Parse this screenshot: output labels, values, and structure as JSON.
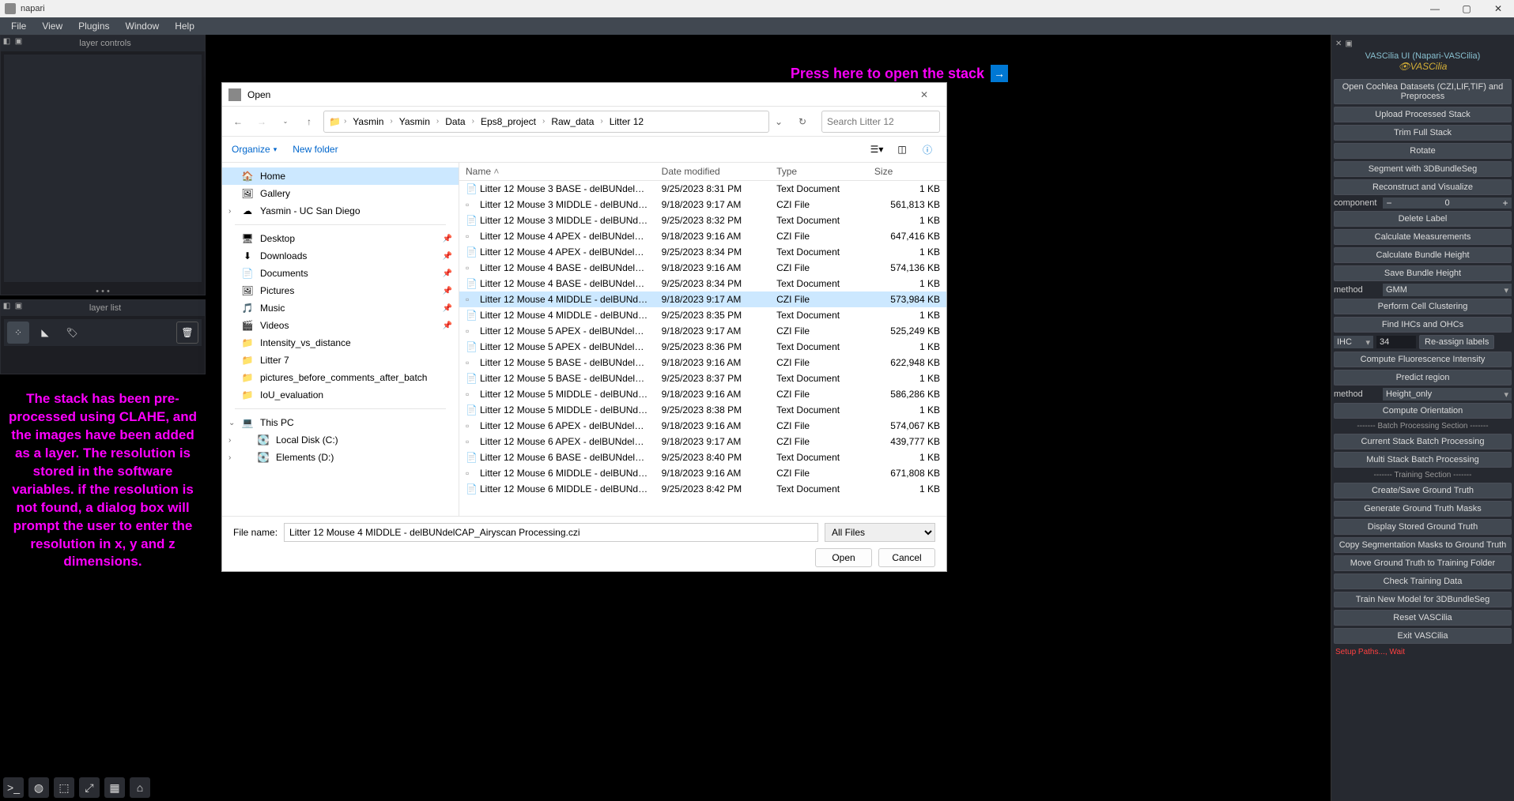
{
  "title": "napari",
  "menu": [
    "File",
    "View",
    "Plugins",
    "Window",
    "Help"
  ],
  "panels": {
    "layer_controls": "layer controls",
    "layer_list": "layer list"
  },
  "annotations": {
    "left": "The stack has been pre-processed using CLAHE, and the images have been added as a layer. The resolution is stored in the software variables. if the resolution is not found, a dialog box will prompt the user to enter the resolution in x, y and z dimensions.",
    "top": "Press here to open the stack"
  },
  "dialog": {
    "title": "Open",
    "breadcrumb": [
      "Yasmin",
      "Yasmin",
      "Data",
      "Eps8_project",
      "Raw_data",
      "Litter 12"
    ],
    "search_placeholder": "Search Litter 12",
    "organize": "Organize",
    "new_folder": "New folder",
    "sidebar_top": [
      {
        "icon": "🏠",
        "label": "Home",
        "selected": true
      },
      {
        "icon": "🖼",
        "label": "Gallery"
      },
      {
        "icon": "☁",
        "label": "Yasmin - UC San Diego",
        "expander": "›"
      }
    ],
    "sidebar_mid": [
      {
        "icon": "🖥",
        "label": "Desktop",
        "pin": true
      },
      {
        "icon": "⬇",
        "label": "Downloads",
        "pin": true
      },
      {
        "icon": "📄",
        "label": "Documents",
        "pin": true
      },
      {
        "icon": "🖼",
        "label": "Pictures",
        "pin": true
      },
      {
        "icon": "🎵",
        "label": "Music",
        "pin": true
      },
      {
        "icon": "🎬",
        "label": "Videos",
        "pin": true
      },
      {
        "icon": "📁",
        "label": "Intensity_vs_distance"
      },
      {
        "icon": "📁",
        "label": "Litter 7"
      },
      {
        "icon": "📁",
        "label": "pictures_before_comments_after_batch"
      },
      {
        "icon": "📁",
        "label": "IoU_evaluation"
      }
    ],
    "sidebar_bot": [
      {
        "icon": "💻",
        "label": "This PC",
        "expander": "⌄"
      },
      {
        "icon": "💽",
        "label": "Local Disk (C:)",
        "indent": true,
        "expander": "›"
      },
      {
        "icon": "💽",
        "label": "Elements (D:)",
        "indent": true,
        "expander": "›"
      }
    ],
    "columns": [
      "Name",
      "Date modified",
      "Type",
      "Size"
    ],
    "files": [
      {
        "name": "Litter 12 Mouse 3 BASE - delBUNdelCAP_...",
        "date": "9/25/2023 8:31 PM",
        "type": "Text Document",
        "size": "1 KB"
      },
      {
        "name": "Litter 12 Mouse 3 MIDDLE - delBUNdelC...",
        "date": "9/18/2023 9:17 AM",
        "type": "CZI File",
        "size": "561,813 KB"
      },
      {
        "name": "Litter 12 Mouse 3 MIDDLE - delBUNdelC...",
        "date": "9/25/2023 8:32 PM",
        "type": "Text Document",
        "size": "1 KB"
      },
      {
        "name": "Litter 12 Mouse 4 APEX - delBUNdelCAP_...",
        "date": "9/18/2023 9:16 AM",
        "type": "CZI File",
        "size": "647,416 KB"
      },
      {
        "name": "Litter 12 Mouse 4 APEX - delBUNdelCAP_...",
        "date": "9/25/2023 8:34 PM",
        "type": "Text Document",
        "size": "1 KB"
      },
      {
        "name": "Litter 12 Mouse 4 BASE - delBUNdelCAP_...",
        "date": "9/18/2023 9:16 AM",
        "type": "CZI File",
        "size": "574,136 KB"
      },
      {
        "name": "Litter 12 Mouse 4 BASE - delBUNdelCAP_...",
        "date": "9/25/2023 8:34 PM",
        "type": "Text Document",
        "size": "1 KB"
      },
      {
        "name": "Litter 12 Mouse 4 MIDDLE - delBUNdelC...",
        "date": "9/18/2023 9:17 AM",
        "type": "CZI File",
        "size": "573,984 KB",
        "selected": true
      },
      {
        "name": "Litter 12 Mouse 4 MIDDLE - delBUNdelC...",
        "date": "9/25/2023 8:35 PM",
        "type": "Text Document",
        "size": "1 KB"
      },
      {
        "name": "Litter 12 Mouse 5 APEX - delBUNdelCAP_...",
        "date": "9/18/2023 9:17 AM",
        "type": "CZI File",
        "size": "525,249 KB"
      },
      {
        "name": "Litter 12 Mouse 5 APEX - delBUNdelCAP_...",
        "date": "9/25/2023 8:36 PM",
        "type": "Text Document",
        "size": "1 KB"
      },
      {
        "name": "Litter 12 Mouse 5 BASE - delBUNdelCAP_...",
        "date": "9/18/2023 9:16 AM",
        "type": "CZI File",
        "size": "622,948 KB"
      },
      {
        "name": "Litter 12 Mouse 5 BASE - delBUNdelCAP_...",
        "date": "9/25/2023 8:37 PM",
        "type": "Text Document",
        "size": "1 KB"
      },
      {
        "name": "Litter 12 Mouse 5 MIDDLE - delBUNdelC...",
        "date": "9/18/2023 9:16 AM",
        "type": "CZI File",
        "size": "586,286 KB"
      },
      {
        "name": "Litter 12 Mouse 5 MIDDLE - delBUNdelC...",
        "date": "9/25/2023 8:38 PM",
        "type": "Text Document",
        "size": "1 KB"
      },
      {
        "name": "Litter 12 Mouse 6 APEX - delBUNdelCAP_...",
        "date": "9/18/2023 9:16 AM",
        "type": "CZI File",
        "size": "574,067 KB"
      },
      {
        "name": "Litter 12 Mouse 6 APEX - delBUNdelCAP_...",
        "date": "9/18/2023 9:17 AM",
        "type": "CZI File",
        "size": "439,777 KB"
      },
      {
        "name": "Litter 12 Mouse 6 BASE - delBUNdelCAP_...",
        "date": "9/25/2023 8:40 PM",
        "type": "Text Document",
        "size": "1 KB"
      },
      {
        "name": "Litter 12 Mouse 6 MIDDLE - delBUNdelC...",
        "date": "9/18/2023 9:16 AM",
        "type": "CZI File",
        "size": "671,808 KB"
      },
      {
        "name": "Litter 12 Mouse 6 MIDDLE - delBUNdelC...",
        "date": "9/25/2023 8:42 PM",
        "type": "Text Document",
        "size": "1 KB"
      }
    ],
    "filename_label": "File name:",
    "filename_value": "Litter 12 Mouse 4 MIDDLE - delBUNdelCAP_Airyscan Processing.czi",
    "filter": "All Files",
    "open": "Open",
    "cancel": "Cancel"
  },
  "rp": {
    "title": "VASCilia UI (Napari-VASCilia)",
    "logo": "👁VASCilia",
    "buttons1": [
      "Open Cochlea Datasets (CZI,LIF,TIF) and Preprocess",
      "Upload Processed Stack",
      "Trim Full Stack",
      "Rotate",
      "Segment with 3DBundleSeg",
      "Reconstruct and Visualize"
    ],
    "component_label": "component",
    "component_value": "0",
    "delete_label": "Delete Label",
    "calc_meas": "Calculate Measurements",
    "calc_bundle": "Calculate Bundle Height",
    "save_bundle": "Save Bundle Height",
    "method_label": "method",
    "method1": "GMM",
    "perform_cluster": "Perform Cell Clustering",
    "find_ihc": "Find IHCs and OHCs",
    "ihc_label": "IHC",
    "ihc_value": "34",
    "reassign": "Re-assign labels",
    "compute_fluor": "Compute Fluorescence Intensity",
    "predict": "Predict region",
    "method2_label": "method",
    "method2": "Height_only",
    "compute_orient": "Compute Orientation",
    "batch_section": "------- Batch Processing Section -------",
    "batch_buttons": [
      "Current Stack Batch Processing",
      "Multi Stack Batch Processing"
    ],
    "train_section": "------- Training Section -------",
    "train_buttons": [
      "Create/Save Ground Truth",
      "Generate Ground Truth Masks",
      "Display Stored Ground Truth",
      "Copy Segmentation Masks to Ground Truth",
      "Move Ground Truth to Training Folder",
      "Check Training Data",
      "Train New Model for 3DBundleSeg",
      "Reset VASCilia",
      "Exit VASCilia"
    ],
    "status": "Setup Paths..., Wait"
  }
}
